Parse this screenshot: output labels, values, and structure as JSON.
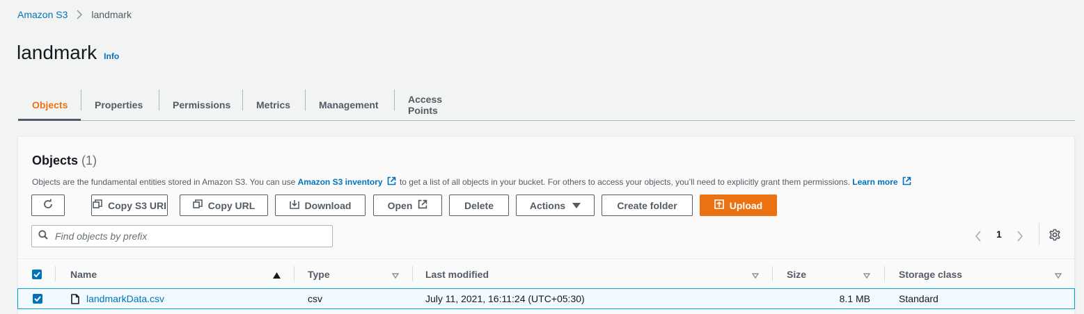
{
  "breadcrumb": {
    "root": "Amazon S3",
    "current": "landmark"
  },
  "page": {
    "title": "landmark",
    "info": "Info"
  },
  "tabs": [
    {
      "label": "Objects",
      "active": true
    },
    {
      "label": "Properties",
      "active": false
    },
    {
      "label": "Permissions",
      "active": false
    },
    {
      "label": "Metrics",
      "active": false
    },
    {
      "label": "Management",
      "active": false
    },
    {
      "label": "Access Points",
      "active": false
    }
  ],
  "objects_panel": {
    "title": "Objects",
    "count": "(1)",
    "description_part1": "Objects are the fundamental entities stored in Amazon S3. You can use ",
    "inventory_link": "Amazon S3 inventory",
    "description_part2": " to get a list of all objects in your bucket. For others to access your objects, you’ll need to explicitly grant them permissions. ",
    "learn_more": "Learn more"
  },
  "toolbar": {
    "copy_s3_uri": "Copy S3 URI",
    "copy_url": "Copy URL",
    "download": "Download",
    "open": "Open",
    "delete": "Delete",
    "actions": "Actions",
    "create_folder": "Create folder",
    "upload": "Upload"
  },
  "search": {
    "placeholder": "Find objects by prefix",
    "value": ""
  },
  "pagination": {
    "current_page": "1"
  },
  "table": {
    "columns": [
      "Name",
      "Type",
      "Last modified",
      "Size",
      "Storage class"
    ],
    "select_all_checked": true,
    "rows": [
      {
        "selected": true,
        "name": "landmarkData.csv",
        "type": "csv",
        "last_modified": "July 11, 2021, 16:11:24 (UTC+05:30)",
        "size": "8.1 MB",
        "storage_class": "Standard"
      }
    ]
  },
  "colors": {
    "accent_orange": "#ec7211",
    "link_blue": "#0073bb",
    "selected_row_border": "#00a1c9",
    "selected_row_bg": "#f1faff"
  },
  "icons": {
    "breadcrumb_separator": "chevron-right-icon",
    "refresh": "refresh-icon",
    "copy": "copy-icon",
    "download": "download-icon",
    "external": "external-link-icon",
    "caret": "caret-down-icon",
    "upload": "upload-icon",
    "search": "search-icon",
    "prev": "chevron-left-icon",
    "next": "chevron-right-icon",
    "settings": "gear-icon",
    "sort_asc": "sort-ascending-icon",
    "sort": "sort-icon",
    "file": "file-icon",
    "checkbox": "checkbox-checked-icon"
  }
}
